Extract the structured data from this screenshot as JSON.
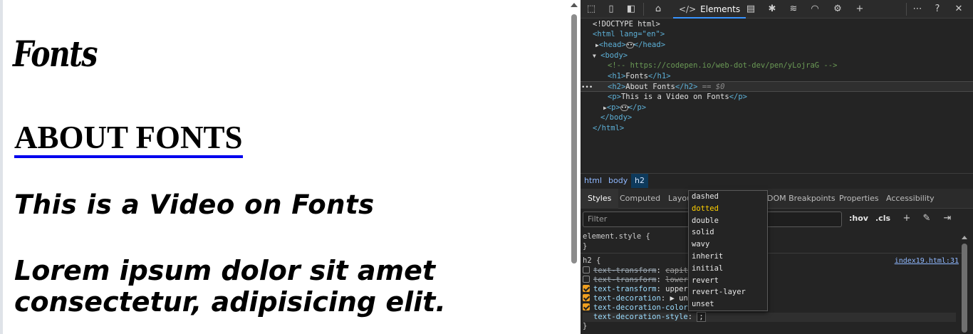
{
  "page": {
    "h1": "Fonts",
    "h2": "About Fonts",
    "p1": "This is a Video on Fonts",
    "p2_line1": "Lorem ipsum dolor sit amet",
    "p2_line2": "consectetur, adipisicing elit."
  },
  "toolbar": {
    "elements_tab": "Elements",
    "icons": [
      "inspect-icon",
      "device-toolbar-icon",
      "sidebar-toggle-icon",
      "home-icon",
      "console-icon",
      "bug-icon",
      "network-icon",
      "performance-icon",
      "settings-chip-icon",
      "add-tab-icon",
      "more-icon",
      "help-icon",
      "close-icon"
    ]
  },
  "dom": {
    "doctype": "<!DOCTYPE html>",
    "html_open": "<html lang=\"en\">",
    "head": "<head>",
    "head_close": "</head>",
    "body_open": "<body>",
    "comment": "<!-- https://codepen.io/web-dot-dev/pen/yLojraG -->",
    "h1_open": "<h1>",
    "h1_text": "Fonts",
    "h1_close": "</h1>",
    "h2_open": "<h2>",
    "h2_text": "About Fonts",
    "h2_close": "</h2>",
    "h2_marker": "== $0",
    "p_open": "<p>",
    "p_text": "This is a Video on Fonts",
    "p_close": "</p>",
    "p2_open": "<p>",
    "p2_close": "</p>",
    "body_close": "</body>",
    "html_close": "</html>",
    "gutter_dots": "•••"
  },
  "breadcrumb": [
    "html",
    "body",
    "h2"
  ],
  "styles_tabs": {
    "styles": "Styles",
    "computed": "Computed",
    "layout": "Layou",
    "dom_breakpoints": "DOM Breakpoints",
    "properties": "Properties",
    "accessibility": "Accessibility"
  },
  "filter": {
    "placeholder": "Filter",
    "hov": ":hov",
    "cls": ".cls"
  },
  "rules": {
    "element_style": "element.style {",
    "close_brace": "}",
    "h2_selector": "h2 {",
    "source": "index19.html:31",
    "props": [
      {
        "name": "text-transform",
        "value": "capita",
        "checked": false,
        "struck": true
      },
      {
        "name": "text-transform",
        "value": "lowerc",
        "checked": false,
        "struck": true
      },
      {
        "name": "text-transform",
        "value": "upperc",
        "checked": true,
        "struck": false
      },
      {
        "name": "text-decoration",
        "value": "▶ unde",
        "checked": true,
        "struck": false
      },
      {
        "name": "text-decoration-color",
        "value": "",
        "checked": true,
        "struck": false
      },
      {
        "name": "text-decoration-style",
        "value": ";",
        "checked": false,
        "struck": false
      }
    ]
  },
  "autocomplete": {
    "items": [
      "dashed",
      "dotted",
      "double",
      "solid",
      "wavy",
      "inherit",
      "initial",
      "revert",
      "revert-layer",
      "unset"
    ],
    "highlighted": "dotted"
  }
}
